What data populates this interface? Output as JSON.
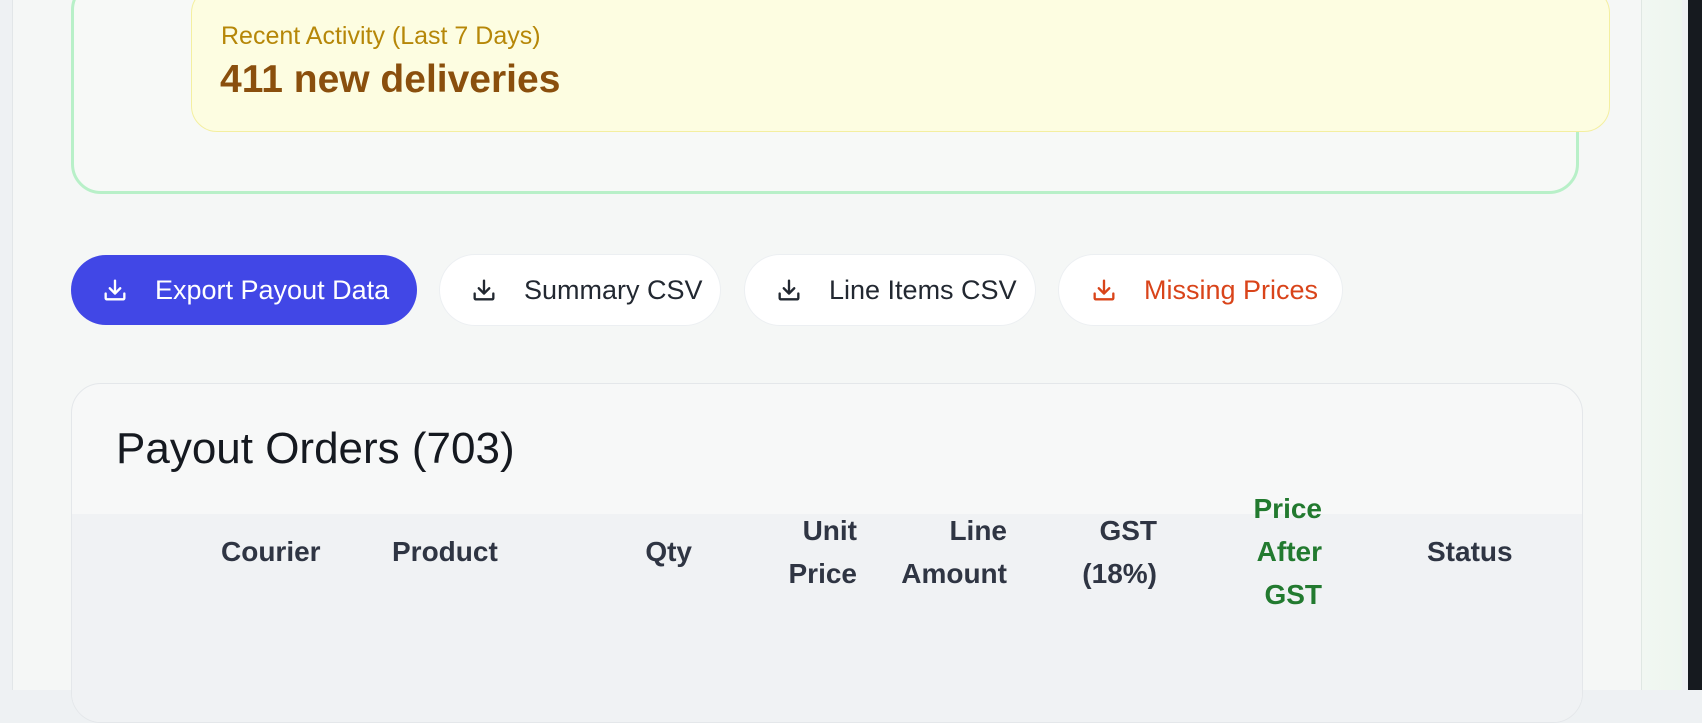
{
  "activity": {
    "label": "Recent Activity (Last 7 Days)",
    "value": "411 new deliveries",
    "colors": {
      "label": "#b68708",
      "value": "#8a4f0d",
      "background": "#fdfde1"
    }
  },
  "actions": {
    "export": {
      "label": "Export Payout Data",
      "icon": "download-icon"
    },
    "summary_csv": {
      "label": "Summary CSV",
      "icon": "download-icon"
    },
    "line_items_csv": {
      "label": "Line Items CSV",
      "icon": "download-icon"
    },
    "missing_prices": {
      "label": "Missing Prices",
      "icon": "download-icon"
    }
  },
  "colors": {
    "primary": "#4147e6",
    "danger": "#d9441a",
    "success": "#227a2f"
  },
  "orders": {
    "title": "Payout Orders (703)",
    "columns": {
      "courier": "Courier",
      "product": "Product",
      "qty": "Qty",
      "unit_price": [
        "Unit",
        "Price"
      ],
      "line_amount": [
        "Line",
        "Amount"
      ],
      "gst": [
        "GST",
        "(18%)"
      ],
      "price_after_gst": [
        "Price",
        "After",
        "GST"
      ],
      "status": "Status"
    }
  }
}
